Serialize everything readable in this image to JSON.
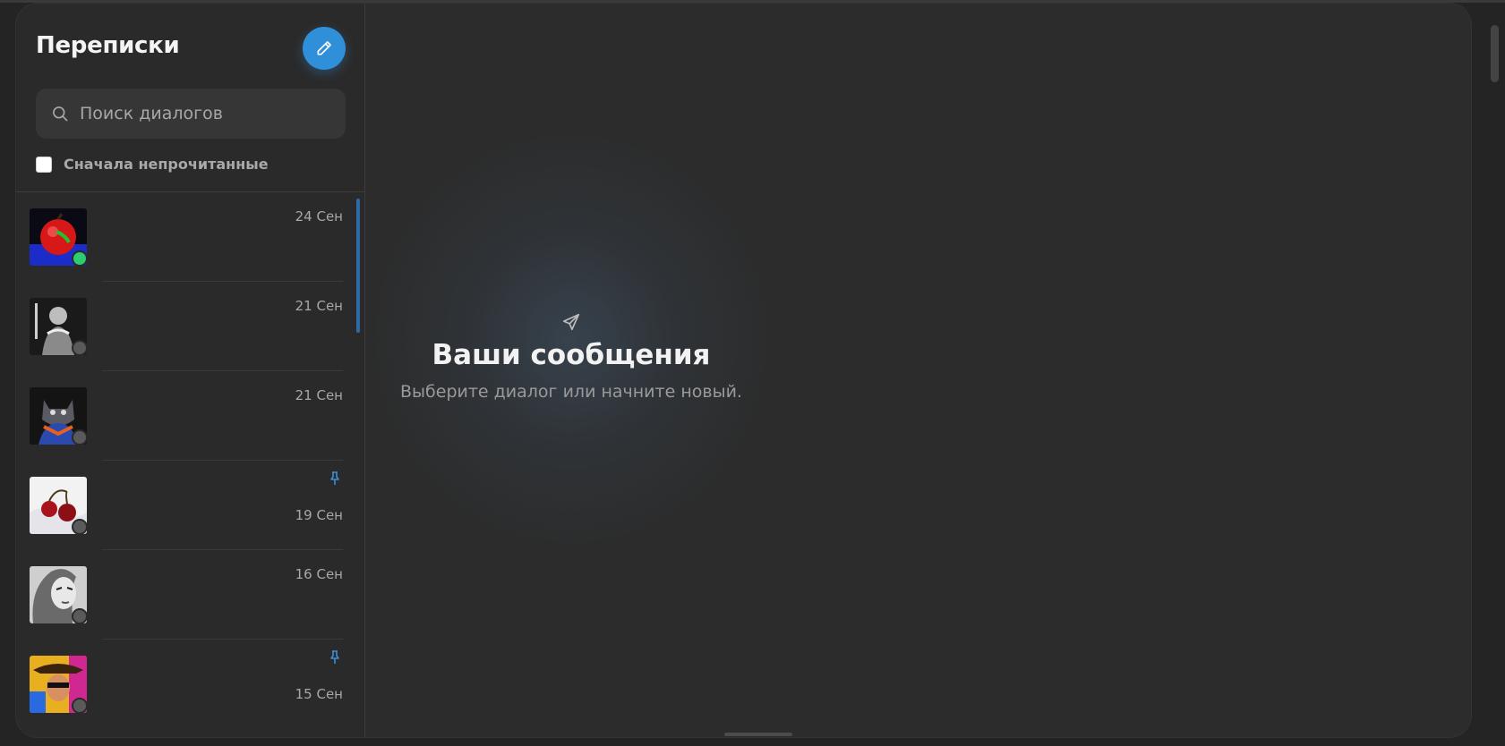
{
  "sidebar": {
    "title": "Переписки",
    "compose_icon": "pencil-icon",
    "search": {
      "placeholder": "Поиск диалогов",
      "value": "",
      "icon": "search-icon"
    },
    "filter": {
      "label": "Сначала непрочитанные",
      "checked": false
    },
    "dialogs": [
      {
        "date": "24 Сен",
        "pinned": false,
        "status": "online",
        "avatar": "red-apple-avatar"
      },
      {
        "date": "21 Сен",
        "pinned": false,
        "status": "offline",
        "avatar": "warrior-avatar"
      },
      {
        "date": "21 Сен",
        "pinned": false,
        "status": "offline",
        "avatar": "cat-avatar"
      },
      {
        "date": "19 Сен",
        "pinned": true,
        "status": "offline",
        "avatar": "cherries-avatar"
      },
      {
        "date": "16 Сен",
        "pinned": false,
        "status": "offline",
        "avatar": "girl-portrait-avatar"
      },
      {
        "date": "15 Сен",
        "pinned": true,
        "status": "offline",
        "avatar": "cowboy-avatar"
      }
    ]
  },
  "main": {
    "icon": "paper-plane-icon",
    "title": "Ваши сообщения",
    "subtitle": "Выберите диалог или начните новый."
  },
  "colors": {
    "accent": "#2f8fd9",
    "online": "#2ecc71",
    "background": "#2c2c2c"
  }
}
